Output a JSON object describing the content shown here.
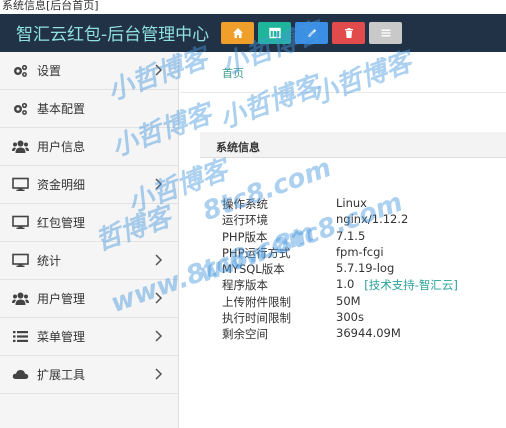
{
  "top_strip_text": "系统信息[后台首页]",
  "header": {
    "title": "智汇云红包-后台管理中心",
    "buttons": [
      {
        "icon": "home-icon",
        "color": "#f0a02a"
      },
      {
        "icon": "table-icon",
        "color": "#1fb59a"
      },
      {
        "icon": "pencil-icon",
        "color": "#3a8ee6"
      },
      {
        "icon": "trash-icon",
        "color": "#e24b4b"
      },
      {
        "icon": "list-icon",
        "color": "#c9c9c9"
      }
    ]
  },
  "sidebar": {
    "items": [
      {
        "label": "设置",
        "icon": "gears-icon",
        "has_arrow": true
      },
      {
        "label": "基本配置",
        "icon": "gears-icon",
        "has_arrow": false
      },
      {
        "label": "用户信息",
        "icon": "users-icon",
        "has_arrow": false
      },
      {
        "label": "资金明细",
        "icon": "monitor-icon",
        "has_arrow": true
      },
      {
        "label": "红包管理",
        "icon": "monitor-icon",
        "has_arrow": false
      },
      {
        "label": "统计",
        "icon": "monitor-icon",
        "has_arrow": true
      },
      {
        "label": "用户管理",
        "icon": "users-icon",
        "has_arrow": true
      },
      {
        "label": "菜单管理",
        "icon": "list-icon",
        "has_arrow": true
      },
      {
        "label": "扩展工具",
        "icon": "cloud-icon",
        "has_arrow": true
      }
    ]
  },
  "main": {
    "breadcrumb": "首页",
    "panel_title": "系统信息",
    "info": [
      {
        "key": "操作系统",
        "value": "Linux"
      },
      {
        "key": "运行环境",
        "value": "nginx/1.12.2"
      },
      {
        "key": "PHP版本",
        "value": "7.1.5"
      },
      {
        "key": "PHP运行方式",
        "value": "fpm-fcgi"
      },
      {
        "key": "MYSQL版本",
        "value": "5.7.19-log"
      },
      {
        "key": "程序版本",
        "value": "1.0",
        "link": "[技术支持-智汇云]"
      },
      {
        "key": "上传附件限制",
        "value": "50M"
      },
      {
        "key": "执行时间限制",
        "value": "300s"
      },
      {
        "key": "剩余空间",
        "value": "36944.09M"
      }
    ]
  },
  "watermark": {
    "lines": [
      "小哲博客",
      "小哲博客",
      "小哲博客",
      "小哲博客",
      "小哲博客",
      "小哲博客",
      "哲博客",
      "8tc8.com",
      "www.8tc8.com",
      "www.8tc8.com"
    ]
  }
}
